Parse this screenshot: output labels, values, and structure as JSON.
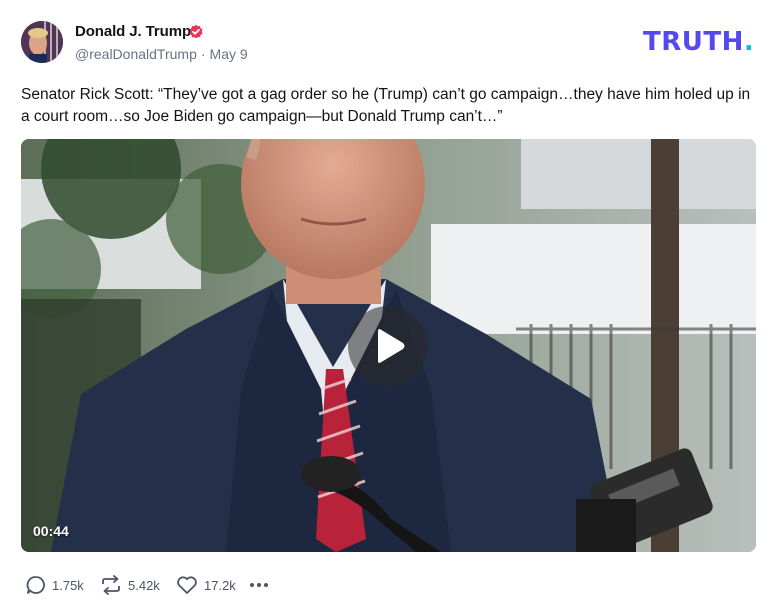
{
  "author": {
    "name": "Donald J. Trump",
    "handle": "@realDonaldTrump",
    "separator": "·",
    "date": "May 9"
  },
  "brand": {
    "logo_text": "TRUTH",
    "logo_period": ".",
    "logo_color": "#5448ee",
    "period_color": "#0bbde2"
  },
  "post": {
    "text": "Senator Rick Scott: “They’ve got a gag order so he (Trump) can’t go campaign…they have him holed up in a court room…so Joe Biden go campaign—but Donald Trump can’t…”"
  },
  "video": {
    "duration": "00:44",
    "play_icon": "play-icon"
  },
  "actions": {
    "replies": "1.75k",
    "retruths": "5.42k",
    "likes": "17.2k",
    "icons": [
      "comment-icon",
      "retruth-icon",
      "heart-icon",
      "more-icon"
    ]
  },
  "colors": {
    "verified": "#e8365d",
    "text": "#111418",
    "muted": "#6b7280"
  }
}
